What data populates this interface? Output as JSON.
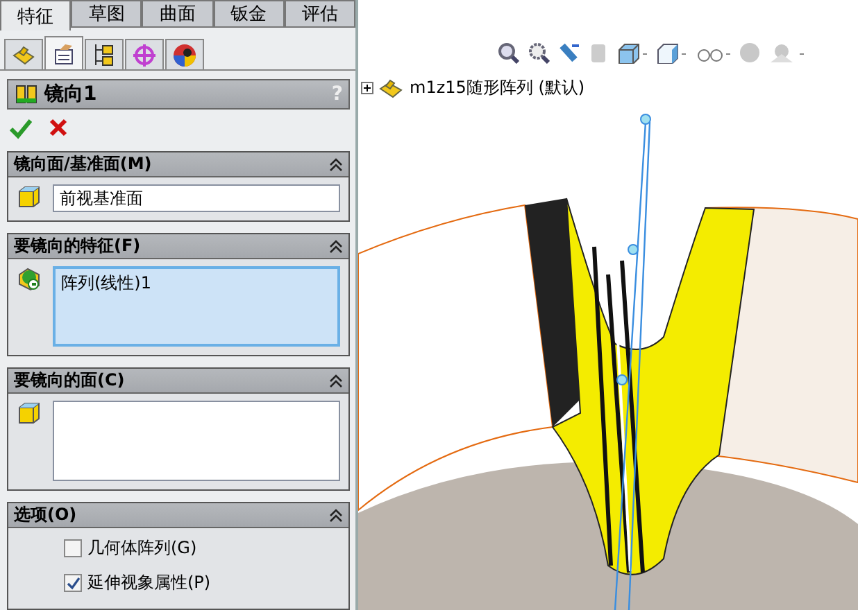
{
  "tabs": [
    {
      "label": "特征",
      "selected": true
    },
    {
      "label": "草图",
      "selected": false
    },
    {
      "label": "曲面",
      "selected": false
    },
    {
      "label": "钣金",
      "selected": false
    },
    {
      "label": "评估",
      "selected": false
    }
  ],
  "panel_tabs": [
    {
      "kind": "part",
      "selected": false
    },
    {
      "kind": "property",
      "selected": true
    },
    {
      "kind": "config",
      "selected": false
    },
    {
      "kind": "target",
      "selected": false
    },
    {
      "kind": "display",
      "selected": false
    }
  ],
  "feature": {
    "title": "镜向1",
    "help": "?"
  },
  "sections": [
    {
      "title": "镜向面/基准面(M)",
      "kind": "field",
      "value": "前视基准面",
      "focused": false
    },
    {
      "title": "要镜向的特征(F)",
      "kind": "list",
      "value": "阵列(线性)1",
      "focused": true
    },
    {
      "title": "要镜向的面(C)",
      "kind": "list",
      "focused": false
    },
    {
      "title": "选项(O)",
      "kind": "options",
      "options": [
        {
          "label": "几何体阵列(G)",
          "checked": false
        },
        {
          "label": "延伸视象属性(P)",
          "checked": true
        }
      ]
    }
  ],
  "tree": {
    "label": "m1z15随形阵列 (默认)"
  }
}
